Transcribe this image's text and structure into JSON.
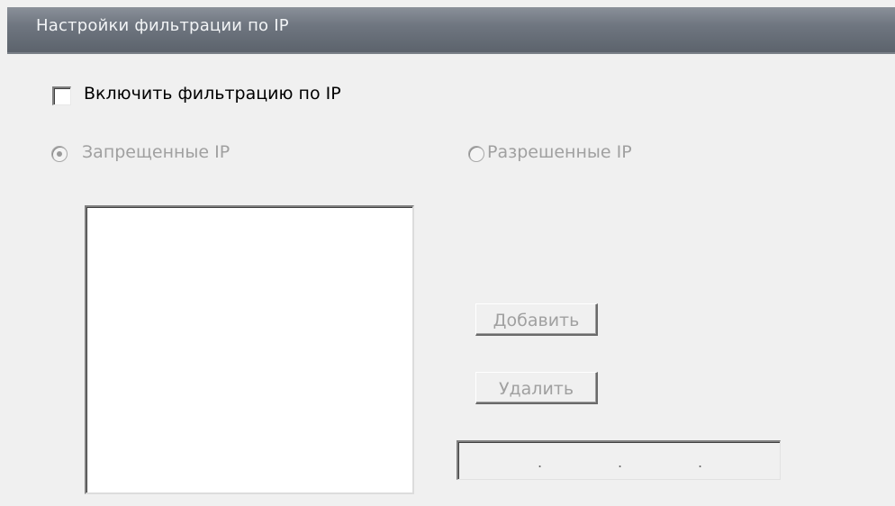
{
  "window": {
    "title": "Настройки фильтрации по IP"
  },
  "filter": {
    "enable_label": "Включить фильтрацию по IP",
    "enabled": false,
    "mode": {
      "deny_label": "Запрещенные IP",
      "allow_label": "Разрешенные IP",
      "selected": "deny"
    },
    "ip_list": []
  },
  "buttons": {
    "add_label": "Добавить",
    "delete_label": "Удалить"
  },
  "ip_input": {
    "separator": ".",
    "octets": [
      "",
      "",
      "",
      ""
    ]
  },
  "colors": {
    "titlebar": "#6f7680",
    "title_text": "#f2f4f6",
    "disabled_text": "#a0a0a0",
    "background": "#f0f0f0"
  },
  "icons": {
    "checkbox": "checkbox-icon",
    "radio": "radio-icon"
  }
}
